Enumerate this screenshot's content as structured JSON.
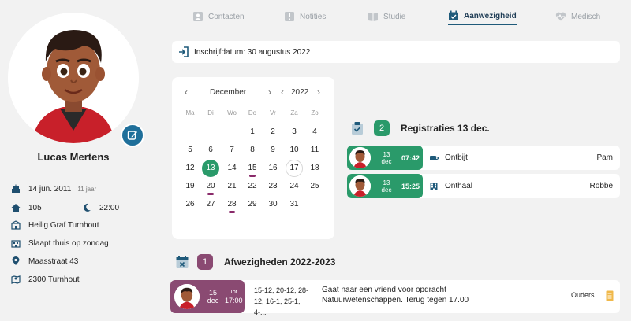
{
  "profile": {
    "name": "Lucas Mertens",
    "birthdate": "14 jun. 2011",
    "age": "11 jaar",
    "room": "105",
    "bedtime": "22:00",
    "school": "Heilig Graf Turnhout",
    "weekend": "Slaapt thuis op zondag",
    "street": "Maasstraat 43",
    "city": "2300 Turnhout"
  },
  "tabs": [
    {
      "label": "Contacten",
      "icon": "contacts-icon"
    },
    {
      "label": "Notities",
      "icon": "notes-icon"
    },
    {
      "label": "Studie",
      "icon": "book-icon"
    },
    {
      "label": "Aanwezigheid",
      "icon": "calendar-check-icon"
    },
    {
      "label": "Medisch",
      "icon": "heartbeat-icon"
    }
  ],
  "enrollment": "Inschrijfdatum: 30 augustus 2022",
  "calendar": {
    "month": "December",
    "year": "2022",
    "weekdays": [
      "Ma",
      "Di",
      "Wo",
      "Do",
      "Vr",
      "Za",
      "Zo"
    ],
    "today": 13,
    "ringed": 17,
    "marked": [
      15,
      20,
      28
    ]
  },
  "registrations": {
    "count": "2",
    "title": "Registraties 13 dec.",
    "items": [
      {
        "day": "13",
        "month": "dec",
        "time": "07:42",
        "type": "Ontbijt",
        "icon": "coffee-icon",
        "person": "Pam"
      },
      {
        "day": "13",
        "month": "dec",
        "time": "15:25",
        "type": "Onthaal",
        "icon": "building-icon",
        "person": "Robbe"
      }
    ]
  },
  "absences": {
    "count": "1",
    "title": "Afwezigheden 2022-2023",
    "item": {
      "day": "15",
      "month": "dec",
      "until_label": "Tot",
      "until_time": "17:00",
      "dates": "15-12, 20-12, 28-12, 16-1, 25-1, 4-...",
      "description": "Gaat naar een vriend voor opdracht Natuurwetenschappen. Terug tegen 17.00",
      "reported_by": "Ouders"
    }
  },
  "colors": {
    "accent_green": "#2a9a6a",
    "accent_purple": "#8a4a72",
    "brand_blue": "#1f6f9a"
  }
}
